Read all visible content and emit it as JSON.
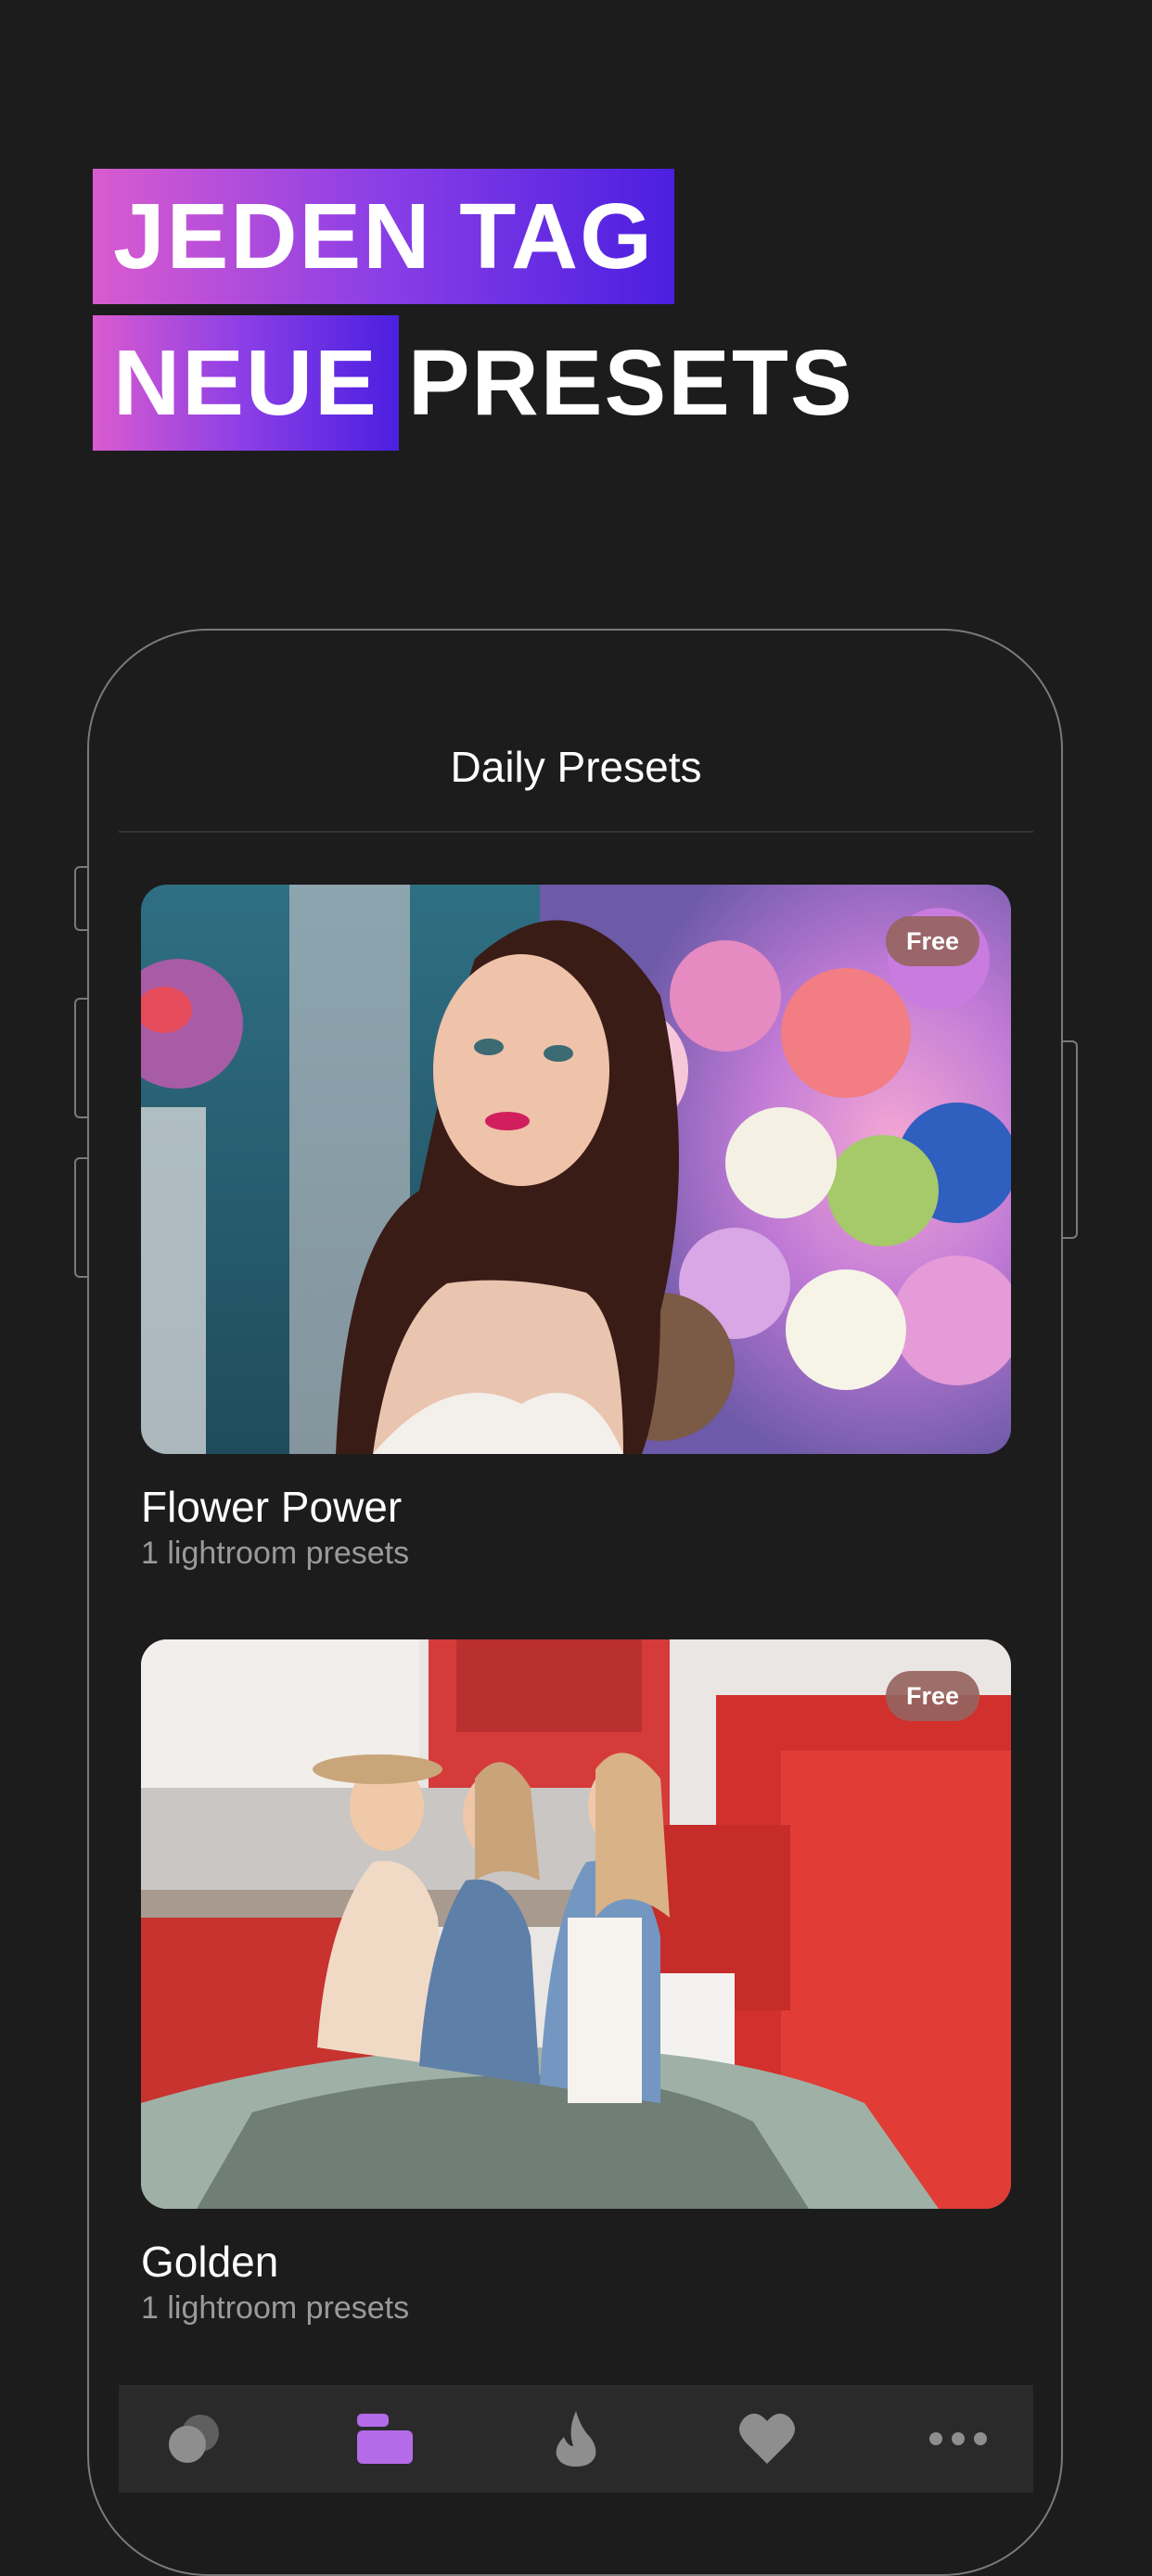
{
  "headline": {
    "line1": "JEDEN TAG",
    "line2_highlight": "NEUE",
    "line2_plain": "PRESETS"
  },
  "screen": {
    "title": "Daily Presets"
  },
  "cards": [
    {
      "title": "Flower Power",
      "subtitle": "1 lightroom presets",
      "badge": "Free"
    },
    {
      "title": "Golden",
      "subtitle": "1 lightroom presets",
      "badge": "Free"
    }
  ],
  "tabbar": {
    "items": [
      {
        "icon": "filters-icon",
        "active": false
      },
      {
        "icon": "presets-folder-icon",
        "active": true
      },
      {
        "icon": "flame-icon",
        "active": false
      },
      {
        "icon": "heart-icon",
        "active": false
      },
      {
        "icon": "more-icon",
        "active": false
      }
    ],
    "active_color": "#b36be8",
    "inactive_color": "#8e8e8e"
  },
  "colors": {
    "background": "#1c1c1d",
    "gradient_start": "#d95bcf",
    "gradient_end": "#4b1fe0"
  }
}
